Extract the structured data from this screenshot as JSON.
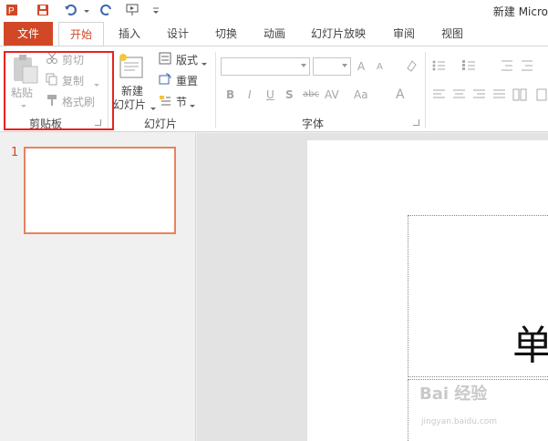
{
  "titlebar": {
    "doc_title": "新建 Micro"
  },
  "tabs": {
    "file": "文件",
    "home": "开始",
    "insert": "插入",
    "design": "设计",
    "transitions": "切换",
    "animations": "动画",
    "slideshow": "幻灯片放映",
    "review": "审阅",
    "view": "视图"
  },
  "clipboard": {
    "paste": "粘贴",
    "cut": "剪切",
    "copy": "复制",
    "format_painter": "格式刷",
    "label": "剪贴板"
  },
  "slides": {
    "new_slide_1": "新建",
    "new_slide_2": "幻灯片",
    "layout": "版式",
    "reset": "重置",
    "section": "节",
    "label": "幻灯片"
  },
  "font": {
    "label": "字体",
    "bold": "B",
    "italic": "I",
    "underline": "U",
    "shadow": "S",
    "strike": "abc",
    "spacing": "AV",
    "case": "Aa",
    "color": "A",
    "grow": "A",
    "shrink": "A"
  },
  "thumbnails": {
    "slide_number": "1"
  },
  "slide": {
    "title_glyph": "单"
  },
  "watermark": {
    "text": "Bai 经验",
    "sub": "jingyan.baidu.com"
  }
}
